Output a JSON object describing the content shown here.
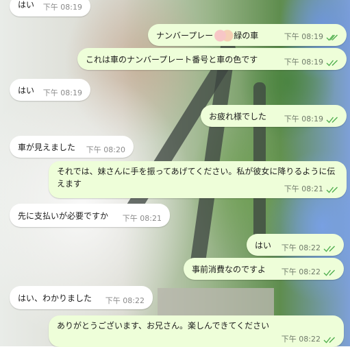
{
  "colors": {
    "incoming_bubble": "#ffffff",
    "outgoing_bubble": "#eefed9",
    "read_check": "#4fae4e"
  },
  "icons": {
    "read_receipt": "double-check-icon",
    "sticker": "couple-emoji-icon"
  },
  "messages": [
    {
      "dir": "in",
      "text": "はい",
      "time": "下午 08:19"
    },
    {
      "dir": "out",
      "text_before": "ナンバープレー",
      "text_after": "緑の車",
      "time": "下午 08:19"
    },
    {
      "dir": "out",
      "text": "これは車のナンバープレート番号と車の色です",
      "time": "下午 08:19"
    },
    {
      "dir": "in",
      "text": "はい",
      "time": "下午 08:19"
    },
    {
      "dir": "out",
      "text": "お疲れ様でした",
      "time": "下午 08:19"
    },
    {
      "dir": "in",
      "text": "車が見えました",
      "time": "下午 08:20"
    },
    {
      "dir": "out",
      "text": "それでは、妹さんに手を振ってあげてください。私が彼女に降りるように伝えます",
      "time": "下午 08:21"
    },
    {
      "dir": "in",
      "text": "先に支払いが必要ですか",
      "time": "下午 08:21"
    },
    {
      "dir": "out",
      "text": "はい",
      "time": "下午 08:22"
    },
    {
      "dir": "out",
      "text": "事前消費なのですよ",
      "time": "下午 08:22"
    },
    {
      "dir": "in",
      "text": "はい、わかりました",
      "time": "下午 08:22"
    },
    {
      "dir": "out",
      "text": "ありがとうございます、お兄さん。楽しんできてください",
      "time": "下午 08:22"
    }
  ]
}
